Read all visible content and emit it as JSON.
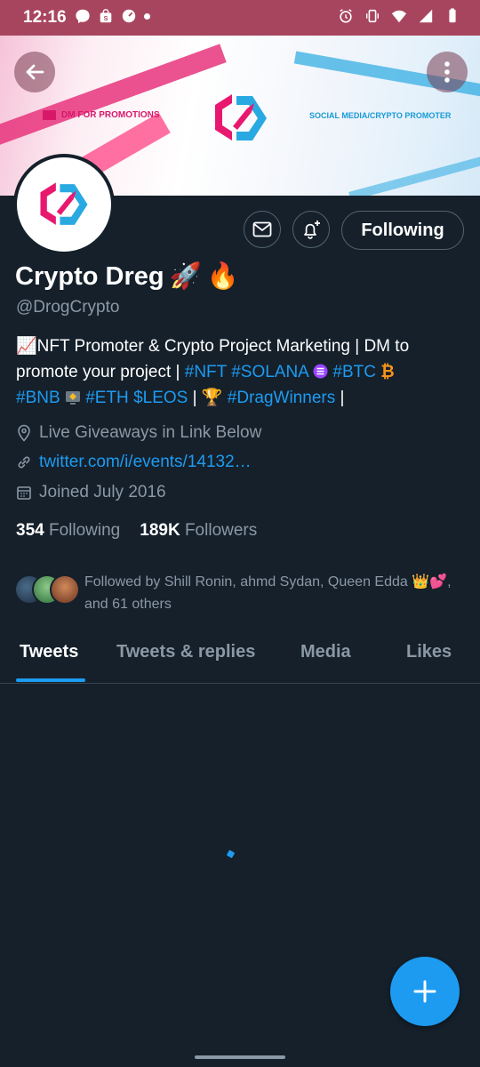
{
  "status_bar": {
    "time": "12:16",
    "left_icons": [
      "messenger-icon",
      "shop-icon",
      "speedometer-icon",
      "dot"
    ],
    "right_icons": [
      "alarm-icon",
      "vibrate-icon",
      "wifi-icon",
      "signal-icon",
      "battery-icon"
    ]
  },
  "banner": {
    "dm_text": "DM FOR PROMOTIONS",
    "social_text": "SOCIAL MEDIA/CRYPTO PROMOTER"
  },
  "profile": {
    "name": "Crypto Dreg",
    "name_emojis": [
      "🚀",
      "🔥"
    ],
    "handle": "@DrogCrypto",
    "bio_line1_text": "📈NFT Promoter & Crypto Project Marketing | DM to",
    "bio_line2_text": "promote your project | ",
    "bio_tag_nft": "#NFT",
    "bio_tag_solana": "#SOLANA",
    "bio_tag_btc": "#BTC",
    "bio_btc_emoji": "₿",
    "bio_tag_bnb": "#BNB",
    "bio_tag_eth": "#ETH",
    "bio_tag_leos": "$LEOS",
    "bio_sep": "|",
    "bio_trophy": "🏆",
    "bio_tag_dragwinners": "#DragWinners",
    "location": "Live Giveaways in Link Below",
    "link": "twitter.com/i/events/14132…",
    "joined": "Joined July 2016"
  },
  "stats": {
    "following_count": "354",
    "following_label": "Following",
    "followers_count": "189K",
    "followers_label": "Followers"
  },
  "followed_by": {
    "text": "Followed by Shill Ronin, ahmd Sydan, Queen Edda 👑💕, and 61 others"
  },
  "buttons": {
    "following": "Following"
  },
  "tabs": [
    {
      "label": "Tweets",
      "active": true
    },
    {
      "label": "Tweets & replies",
      "active": false
    },
    {
      "label": "Media",
      "active": false
    },
    {
      "label": "Likes",
      "active": false
    }
  ],
  "colors": {
    "accent": "#1d9bf0",
    "background": "#15202b",
    "secondary_text": "#8b98a5",
    "status_bar": "#a8455e"
  }
}
